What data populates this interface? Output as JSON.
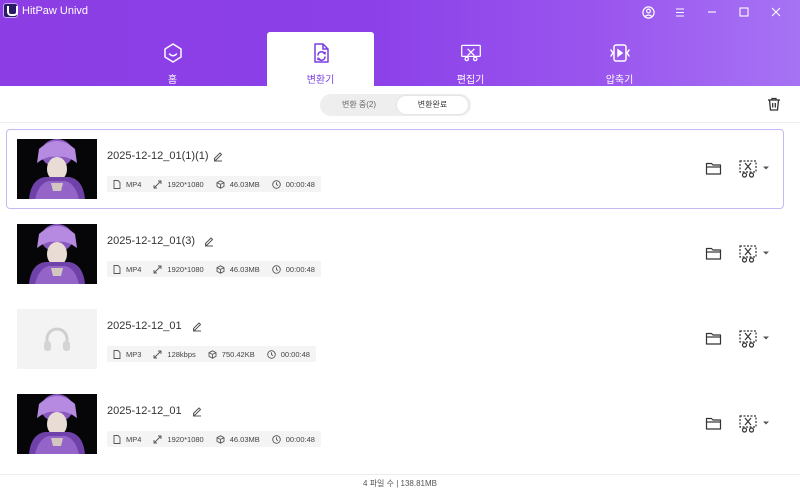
{
  "app": {
    "title": "HitPaw Univd"
  },
  "tabs": [
    {
      "label": "홈",
      "icon": "home-smile-icon"
    },
    {
      "label": "변환기",
      "icon": "convert-icon",
      "active": true
    },
    {
      "label": "편집기",
      "icon": "editor-icon"
    },
    {
      "label": "압축기",
      "icon": "compressor-icon"
    }
  ],
  "segment": {
    "converting": "변환 중(2)",
    "completed": "변환완료",
    "selected": "completed"
  },
  "files": [
    {
      "name": "2025-12-12_01(1)(1)",
      "format": "MP4",
      "resolution": "1920*1080",
      "size": "46.03MB",
      "duration": "00:00:48",
      "type": "video",
      "selected": true
    },
    {
      "name": "2025-12-12_01(3)",
      "format": "MP4",
      "resolution": "1920*1080",
      "size": "46.03MB",
      "duration": "00:00:48",
      "type": "video"
    },
    {
      "name": "2025-12-12_01",
      "format": "MP3",
      "resolution": "128kbps",
      "size": "750.42KB",
      "duration": "00:00:48",
      "type": "audio"
    },
    {
      "name": "2025-12-12_01",
      "format": "MP4",
      "resolution": "1920*1080",
      "size": "46.03MB",
      "duration": "00:00:48",
      "type": "video"
    }
  ],
  "footer": {
    "summary": "4 파일 수 | 138.81MB"
  },
  "colors": {
    "accent": "#7a3fe0",
    "header_start": "#8c3ee4",
    "header_end": "#a673f4",
    "selected_border": "#c7b7f4"
  }
}
